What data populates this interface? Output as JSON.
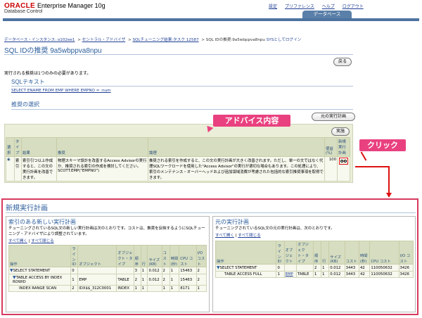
{
  "header": {
    "logo_oracle": "ORACLE",
    "logo_em": "Enterprise Manager 10g",
    "logo_dc": "Database Control",
    "links": [
      "設定",
      "プリファレンス",
      "ヘルプ",
      "ログアウト"
    ],
    "db_tab": "データベース"
  },
  "breadcrumb": {
    "items": [
      "データベース・インスタンス: o102ee1",
      "セントラル・アドバイザ",
      "SQLチューニング結果:タスク 12587"
    ],
    "current": "SQL IDの推奨:9a5wbppva8npu",
    "login": "SYSとしてログイン",
    "sep": ">"
  },
  "page": {
    "title": "SQL IDの推奨 9a5wbppva8npu",
    "message": "実行される推奨は1つのみの必要があります。",
    "back_button": "戻る"
  },
  "sql_section": {
    "title": "SQLテキスト",
    "sql": "SELECT ENAME FROM EMP WHERE EMPNO = :num"
  },
  "rec_section": {
    "title": "推奨の選択",
    "orig_plan_button": "元の実行計画",
    "exec_button": "実施",
    "columns": [
      "選択",
      "タイプ",
      "結果",
      "推奨",
      "論理",
      "使益(%)",
      "新規実行計画"
    ],
    "row": {
      "select": "◉",
      "type": "索引",
      "result": "索引引つ以上作成すると、この文の実行計画を改善できます。",
      "rec": "物理スキーマ設計を改善するAccess Advisorの実行か、推奨される索引の作成を検討してください。 SCOTT.EMP(\"EMPNO\")",
      "logic": "推奨される索引を作成すると、この文の実行計画が大きく改善されます。ただし、単一の文ではなく代理SQLワークロードを使用した\"Access Advisor\"の実行が適切な場合もあります。この処理により、索引のメンテナンス・オーバーヘッドおよび追加領域消費が考慮された包括的な索引推奨事項を取得できます。",
      "benefit": "100",
      "plan_icon": "eyeglasses-icon"
    }
  },
  "annotations": {
    "advice": "アドバイス内容",
    "click": "クリック"
  },
  "plans": {
    "title": "新規実行計画",
    "new": {
      "title": "索引のある新しい実行計画",
      "desc": "チューニングされているSQL文の新しい実行計画は次のとおりです。コストは、推奨を反映するようにSQLチューニング・アドバイザにより調整されています。",
      "links": [
        "すべて開く",
        "すべて閉じる"
      ],
      "columns": [
        "操作",
        "ライン ID",
        "オブジェクト",
        "オブジェクト・タイプ",
        "順序",
        "行",
        "サイズ (KB)",
        "コスト",
        "時間 (秒)",
        "CPU コスト",
        "I/O コスト"
      ],
      "rows": [
        [
          "SELECT STATEMENT",
          "0",
          "",
          "",
          "3",
          "1",
          "0.012",
          "2",
          "1",
          "15463",
          "2"
        ],
        [
          "TABLE ACCESS BY INDEX ROWID",
          "1",
          "EMP",
          "TABLE",
          "2",
          "1",
          "0.012",
          "2",
          "1",
          "15463",
          "2"
        ],
        [
          "INDEX RANGE SCAN",
          "2",
          "IDX$$_312C0001",
          "INDEX",
          "1",
          "1",
          "",
          "1",
          "1",
          "8171",
          "1"
        ]
      ]
    },
    "orig": {
      "title": "元の実行計画",
      "desc": "チューニングされているSQL文の元の実行計画は、次のとおりです。",
      "links": [
        "すべて開く",
        "すべて閉じる"
      ],
      "columns": [
        "操作",
        "ライン ID",
        "オブジェクト",
        "オブジェクト・タイプ",
        "順序",
        "行",
        "サイズ (KB)",
        "コスト",
        "時間 (秒)",
        "CPU コスト",
        "I/O コスト"
      ],
      "rows": [
        [
          "SELECT STATEMENT",
          "0",
          "",
          "",
          "2",
          "1",
          "0.012",
          "3443",
          "42",
          "110050632",
          "3426"
        ],
        [
          "TABLE ACCESS FULL",
          "1",
          "EMP",
          "TABLE",
          "1",
          "1",
          "0.012",
          "3443",
          "42",
          "110050632",
          "3426"
        ]
      ]
    }
  }
}
